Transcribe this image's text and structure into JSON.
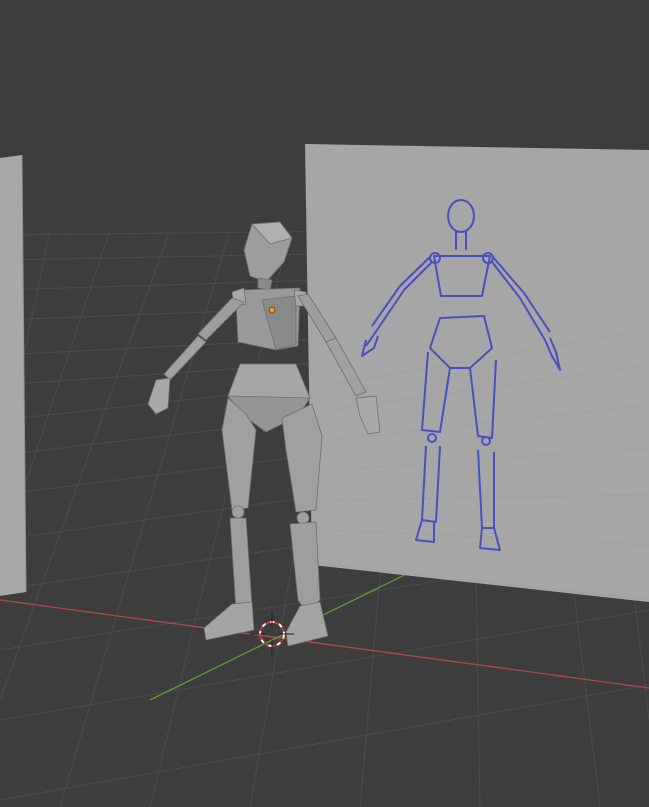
{
  "viewport": {
    "label": "",
    "view": "perspective",
    "background": "#3d3d3d",
    "grid_color": "#4a4a4a",
    "x_axis_color": "#b04a4a",
    "y_axis_color": "#6a9a3a"
  },
  "scene": {
    "objects": [
      {
        "name": "mannequin",
        "kind": "low-poly human figure",
        "color": "#9a9a9a"
      },
      {
        "name": "reference-plane-back",
        "kind": "image plane with blue stick-figure sketch",
        "color": "#a5a5a5",
        "sketch_color": "#4a4fc0"
      },
      {
        "name": "reference-plane-side",
        "kind": "image plane, seen edge-on at left",
        "color": "#a5a5a5"
      }
    ],
    "origin_dot_color": "#f0a020",
    "cursor": "3d-cursor"
  }
}
